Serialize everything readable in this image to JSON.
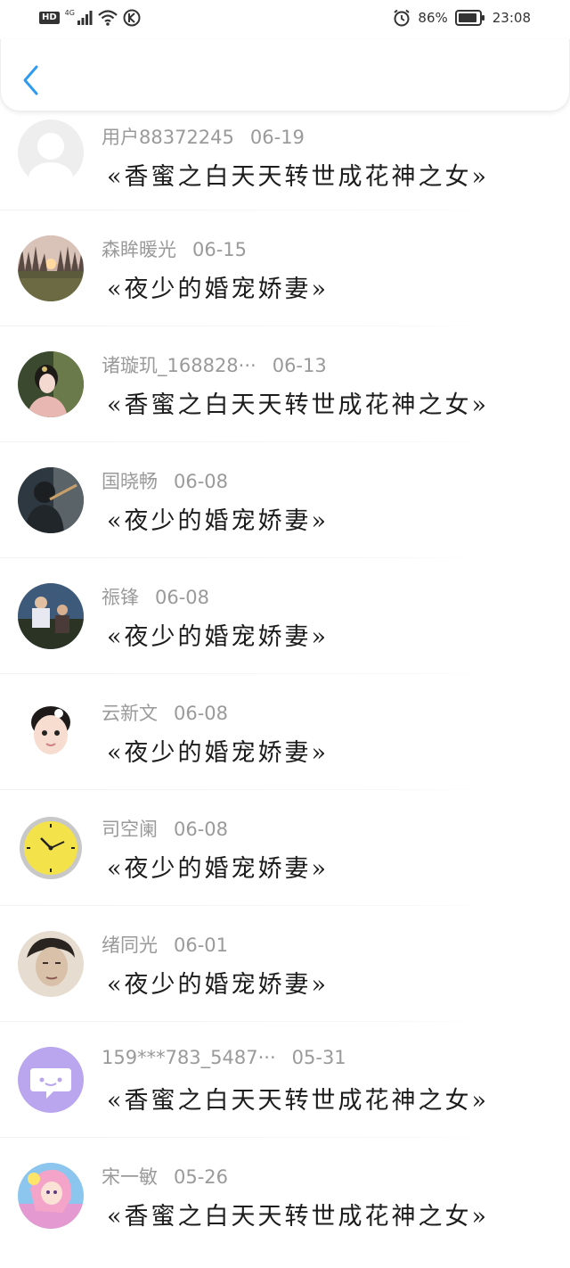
{
  "status_bar": {
    "hd": "HD",
    "network": "4G",
    "battery_percent": "86%",
    "time": "23:08"
  },
  "header": {
    "back_icon": "chevron-left-icon",
    "accent_color": "#2f9bf0"
  },
  "items": [
    {
      "name": "用户88372245",
      "date": "06-19",
      "message": "«香蜜之白天天转世成花神之女»",
      "avatar": "default-user-avatar"
    },
    {
      "name": "森眸暖光",
      "date": "06-15",
      "message": "«夜少的婚宠娇妻»",
      "avatar": "sunset-forest-avatar"
    },
    {
      "name": "诸璇玑_168828···",
      "date": "06-13",
      "message": "«香蜜之白天天转世成花神之女»",
      "avatar": "costume-woman-avatar"
    },
    {
      "name": "国晓畅",
      "date": "06-08",
      "message": "«夜少的婚宠娇妻»",
      "avatar": "dark-character-avatar"
    },
    {
      "name": "祳锋",
      "date": "06-08",
      "message": "«夜少的婚宠娇妻»",
      "avatar": "outdoor-people-avatar"
    },
    {
      "name": "云新文",
      "date": "06-08",
      "message": "«夜少的婚宠娇妻»",
      "avatar": "baby-avatar"
    },
    {
      "name": "司空阑",
      "date": "06-08",
      "message": "«夜少的婚宠娇妻»",
      "avatar": "yellow-clock-avatar"
    },
    {
      "name": "绪同光",
      "date": "06-01",
      "message": "«夜少的婚宠娇妻»",
      "avatar": "man-portrait-avatar"
    },
    {
      "name": "159***783_5487···",
      "date": "05-31",
      "message": "«香蜜之白天天转世成花神之女»",
      "avatar": "purple-chat-avatar"
    },
    {
      "name": "宋一敏",
      "date": "05-26",
      "message": "«香蜜之白天天转世成花神之女»",
      "avatar": "anime-girl-avatar"
    }
  ]
}
